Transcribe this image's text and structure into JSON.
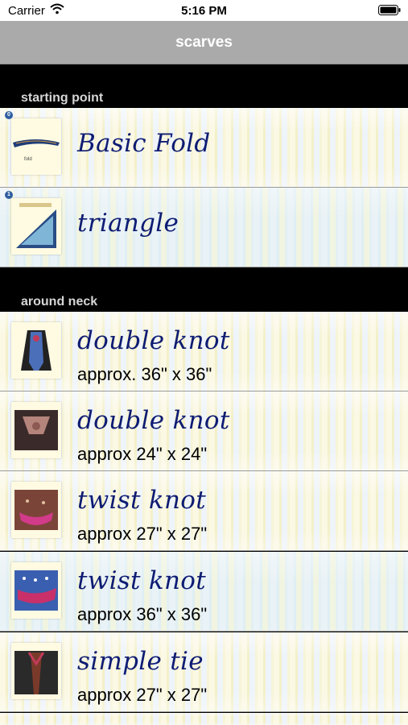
{
  "status_bar": {
    "carrier": "Carrier",
    "time": "5:16 PM"
  },
  "nav": {
    "title": "scarves"
  },
  "sections": [
    {
      "header": "starting point",
      "rows": [
        {
          "badge": "0",
          "title": "Basic Fold"
        },
        {
          "badge": "1",
          "title": "triangle"
        }
      ]
    },
    {
      "header": "around neck",
      "rows": [
        {
          "title": "double knot",
          "subtitle": "approx. 36\" x 36\""
        },
        {
          "title": "double knot",
          "subtitle": "approx 24\" x 24\""
        },
        {
          "title": "twist knot",
          "subtitle": "approx 27\" x 27\""
        },
        {
          "title": "twist knot",
          "subtitle": "approx 36\" x 36\""
        },
        {
          "title": "simple tie",
          "subtitle": "approx 27\" x 27\""
        }
      ]
    }
  ],
  "colors": {
    "nav_bar": "#aaaaaa",
    "title_text": "#0e1c73",
    "section_bg": "#000000"
  },
  "icons": [
    "wifi-icon",
    "battery-icon"
  ]
}
